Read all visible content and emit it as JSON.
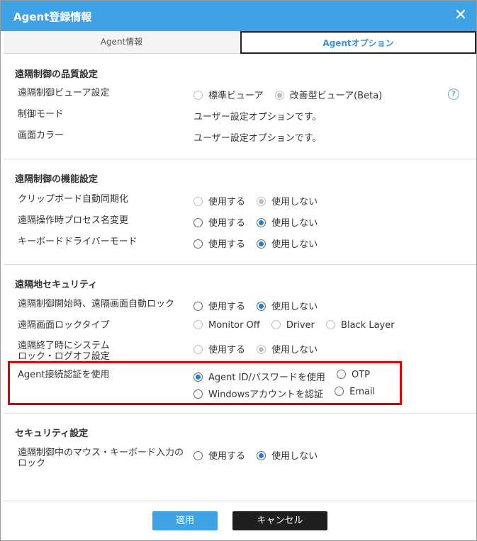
{
  "dialog": {
    "title": "Agent登録情報",
    "close_symbol": "✕"
  },
  "tabs": [
    {
      "label": "Agent情報",
      "active": false
    },
    {
      "label": "Agentオプション",
      "active": true
    }
  ],
  "sections": {
    "quality": {
      "title": "遠隔制御の品質設定",
      "rows": {
        "viewer": {
          "label": "遠隔制御ビューア設定",
          "opt1": "標準ビューア",
          "opt2": "改善型ビューア(Beta)",
          "selected": "opt2",
          "disabled": true
        },
        "control_mode": {
          "label": "制御モード",
          "value": "ユーザー設定オプションです。"
        },
        "screen_color": {
          "label": "画面カラー",
          "value": "ユーザー設定オプションです。"
        }
      }
    },
    "function": {
      "title": "遠隔制御の機能設定",
      "rows": {
        "clipboard": {
          "label": "クリップボード自動同期化",
          "opt1": "使用する",
          "opt2": "使用しない",
          "selected": "opt2",
          "disabled": true
        },
        "process_name": {
          "label": "遠隔操作時プロセス名変更",
          "opt1": "使用する",
          "opt2": "使用しない",
          "selected": "opt2",
          "disabled": false
        },
        "keyboard_driver": {
          "label": "キーボードドライバーモード",
          "opt1": "使用する",
          "opt2": "使用しない",
          "selected": "opt2",
          "disabled": false
        }
      }
    },
    "remote_security": {
      "title": "遠隔地セキュリティ",
      "rows": {
        "auto_lock": {
          "label": "遠隔制御開始時、遠隔画面自動ロック",
          "opt1": "使用する",
          "opt2": "使用しない",
          "selected": "opt2",
          "disabled": false
        },
        "lock_type": {
          "label": "遠隔画面ロックタイプ",
          "opt1": "Monitor Off",
          "opt2": "Driver",
          "opt3": "Black Layer",
          "disabled": true
        },
        "system_lock": {
          "label_line1": "遠隔終了時にシステム",
          "label_line2": "ロック・ログオフ設定",
          "opt1": "使用する",
          "opt2": "使用しない",
          "selected": "opt2",
          "disabled": true
        },
        "agent_auth": {
          "label": "Agent接続認証を使用",
          "opt1": "Agent ID/パスワードを使用",
          "opt2": "OTP",
          "opt3": "Windowsアカウントを認証",
          "opt4": "Email",
          "selected": "opt1",
          "disabled": false
        }
      }
    },
    "security": {
      "title": "セキュリティ設定",
      "rows": {
        "input_lock": {
          "label_line1": "遠隔制御中のマウス・キーボード入力の",
          "label_line2": "ロック",
          "opt1": "使用する",
          "opt2": "使用しない",
          "selected": "opt2",
          "disabled": false
        }
      }
    }
  },
  "help_icon_symbol": "?",
  "footer": {
    "apply_label": "適用",
    "cancel_label": "キャンセル"
  },
  "colors": {
    "titlebar": "#3ea2e5",
    "accent_tab": "#3e8fd6",
    "highlight": "#e00000",
    "radio_checked": "#1e7ed8"
  }
}
